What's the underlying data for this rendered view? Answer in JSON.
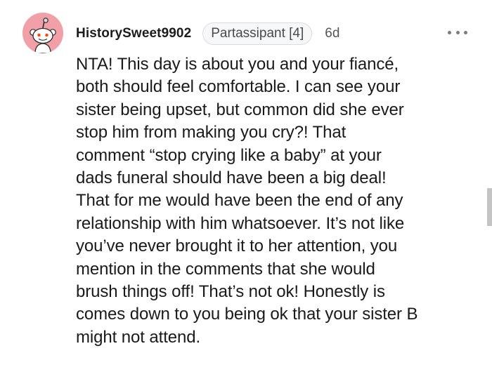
{
  "comment": {
    "username": "HistorySweet9902",
    "flair": "Partassipant [4]",
    "age": "6d",
    "more_icon": "more-horizontal-icon",
    "avatar_icon": "reddit-snoo-avatar-icon",
    "body_lines": [
      "NTA! This day is about you and your fiancé,",
      "both should feel comfortable. I can see your",
      "sister being upset, but common did she ever",
      "stop him from making you cry?! That",
      "comment “stop crying like a baby” at your",
      "dads funeral should have been a big deal!",
      "That for me would have been the end of any",
      "relationship with him whatsoever. It’s not like",
      "you’ve never brought it to her attention, you",
      "mention in the comments that she would",
      "brush things off! That’s not ok! Honestly is",
      "comes down to you being ok that your sister B",
      "might not attend."
    ]
  },
  "colors": {
    "avatar_bg": "#f0a0a6",
    "flair_bg": "#f6f7f8",
    "text": "#1a1a1b",
    "meta_text": "#555555",
    "scrollbar": "#c4c4c4"
  }
}
